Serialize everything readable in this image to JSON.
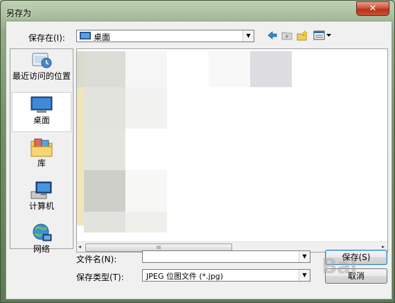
{
  "window": {
    "title": "另存为",
    "close_glyph": "✕"
  },
  "toolbar": {
    "save_in_label": "保存在(I):",
    "save_in_value": "桌面",
    "icons": [
      "back-arrow-icon",
      "up-folder-icon",
      "new-folder-icon",
      "view-menu-icon"
    ]
  },
  "places": [
    {
      "label": "最近访问的位置",
      "icon": "recent-places-icon"
    },
    {
      "label": "桌面",
      "icon": "desktop-icon",
      "selected": true
    },
    {
      "label": "库",
      "icon": "libraries-icon"
    },
    {
      "label": "计算机",
      "icon": "computer-icon"
    },
    {
      "label": "网络",
      "icon": "network-icon"
    }
  ],
  "scrollbar": {
    "left_arrow": "◂",
    "right_arrow": "▸",
    "thumb_grip": "III"
  },
  "filename": {
    "label": "文件名(N):",
    "value": ""
  },
  "filetype": {
    "label": "保存类型(T):",
    "value": "JPEG 位图文件  (*.jpg)"
  },
  "buttons": {
    "save": "保存(S)",
    "cancel": "取消"
  },
  "watermark": "Bai"
}
